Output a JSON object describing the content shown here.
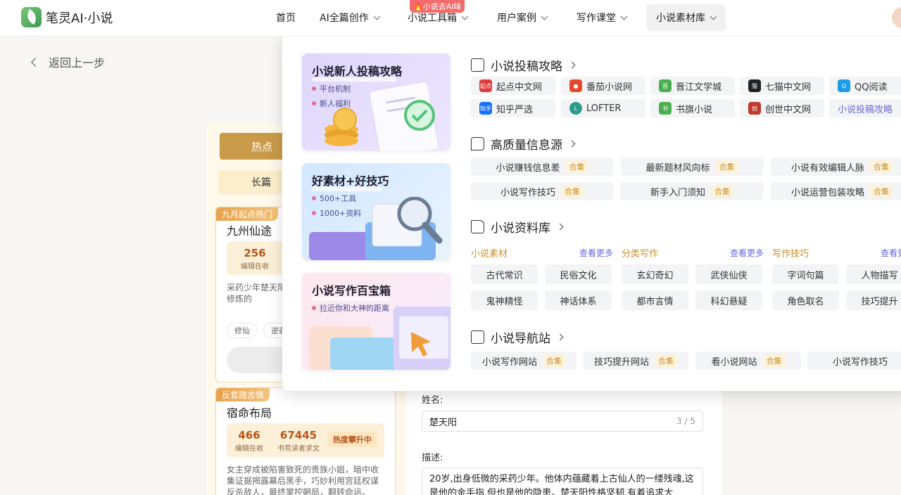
{
  "app": {
    "logo_text": "笔灵AI·小说"
  },
  "nav": {
    "items": [
      "首页",
      "AI全篇创作",
      "小说工具箱",
      "用户案例",
      "写作课堂",
      "小说素材库"
    ],
    "badge": "小说去AI味"
  },
  "back": {
    "label": "返回上一步"
  },
  "filters": {
    "hot": "热点",
    "long": "长篇"
  },
  "cards": [
    {
      "ribbon": "九月起点热门",
      "title": "九州仙途",
      "stat1_num": "256",
      "stat1_label": "编辑在收",
      "desc": "采药少年楚天阳惊人修炼天赋。魂在助他修炼的",
      "chips": [
        "修仙",
        "逆袭"
      ]
    },
    {
      "ribbon": "反套路言情",
      "title": "宿命布局",
      "stat1_num": "466",
      "stat1_label": "编辑在收",
      "stat2_num": "67445",
      "stat2_label": "书荒读者求文",
      "hot_tag": "热度攀升中",
      "desc": "女主穿成被陷害致死的贵族小姐，暗中收集证据揭露幕后黑手，巧妙利用宫廷权谋反杀敌人，最终掌控朝局，翻转命运。"
    }
  ],
  "form": {
    "name_label": "姓名:",
    "name_value": "楚天阳",
    "name_count": "3 / 5",
    "desc_label": "描述:",
    "desc_value": "20岁,出身低微的采药少年。他体内蕴藏着上古仙人的一缕残魂,这是他的金手指,但也是他的隐患。楚天阳性格坚韧,有着追求大"
  },
  "mega": {
    "promos": [
      {
        "title": "小说新人投稿攻略",
        "bullets": [
          "平台机制",
          "新人福利"
        ]
      },
      {
        "title": "好素材+好技巧",
        "bullets": [
          "500+工具",
          "1000+资料"
        ]
      },
      {
        "title": "小说写作百宝箱",
        "bullets": [
          "拉近你和大神的距离"
        ]
      }
    ],
    "sections": {
      "submit": "小说投稿攻略",
      "info": "高质量信息源",
      "library": "小说资料库",
      "navsite": "小说导航站"
    },
    "sites": [
      {
        "name": "起点中文网",
        "icon": "qidian-icon",
        "color": "#e03c3c",
        "glyph": "起点"
      },
      {
        "name": "番茄小说网",
        "icon": "tomato-icon",
        "color": "#e24a2b",
        "glyph": "●"
      },
      {
        "name": "晋江文学城",
        "icon": "jinjiang-icon",
        "color": "#4caf50",
        "glyph": "晋"
      },
      {
        "name": "七猫中文网",
        "icon": "qimao-icon",
        "color": "#222222",
        "glyph": "猫"
      },
      {
        "name": "QQ阅读",
        "icon": "qq-icon",
        "color": "#1c9be6",
        "glyph": "Q"
      },
      {
        "name": "知乎严选",
        "icon": "zhihu-icon",
        "color": "#1772f6",
        "glyph": "知乎"
      },
      {
        "name": "LOFTER",
        "icon": "lofter-icon",
        "color": "#2d9c8c",
        "glyph": "L"
      },
      {
        "name": "书旗小说",
        "icon": "shuqi-icon",
        "color": "#4caf50",
        "glyph": "书"
      },
      {
        "name": "创世中文网",
        "icon": "chuangshi-icon",
        "color": "#c0392b",
        "glyph": "创"
      },
      {
        "name": "小说投稿攻略",
        "icon": "",
        "color": "",
        "glyph": ""
      }
    ],
    "info_pills": [
      {
        "label": "小说赚钱信息差",
        "tag": "合集"
      },
      {
        "label": "最新题材风向标",
        "tag": "合集"
      },
      {
        "label": "小说有效编辑人脉",
        "tag": "合集"
      },
      {
        "label": "小说写作技巧",
        "tag": "合集"
      },
      {
        "label": "新手入门须知",
        "tag": "合集"
      },
      {
        "label": "小说运营包装攻略",
        "tag": "合集"
      }
    ],
    "library_cols": [
      {
        "head": "小说素材",
        "more": "查看更多",
        "items": [
          "古代常识",
          "民俗文化",
          "鬼神精怪",
          "神话体系"
        ]
      },
      {
        "head": "分类写作",
        "more": "查看更多",
        "items": [
          "玄幻奇幻",
          "武侠仙侠",
          "都市言情",
          "科幻悬疑"
        ]
      },
      {
        "head": "写作技巧",
        "more": "查看更多",
        "items": [
          "字词句篇",
          "人物描写",
          "角色取名",
          "技巧提升"
        ]
      }
    ],
    "nav_pills": [
      {
        "label": "小说写作网站",
        "tag": "合集"
      },
      {
        "label": "技巧提升网站",
        "tag": "合集"
      },
      {
        "label": "看小说网站",
        "tag": "合集"
      },
      {
        "label": "小说写作技巧",
        "tag": ""
      }
    ]
  }
}
